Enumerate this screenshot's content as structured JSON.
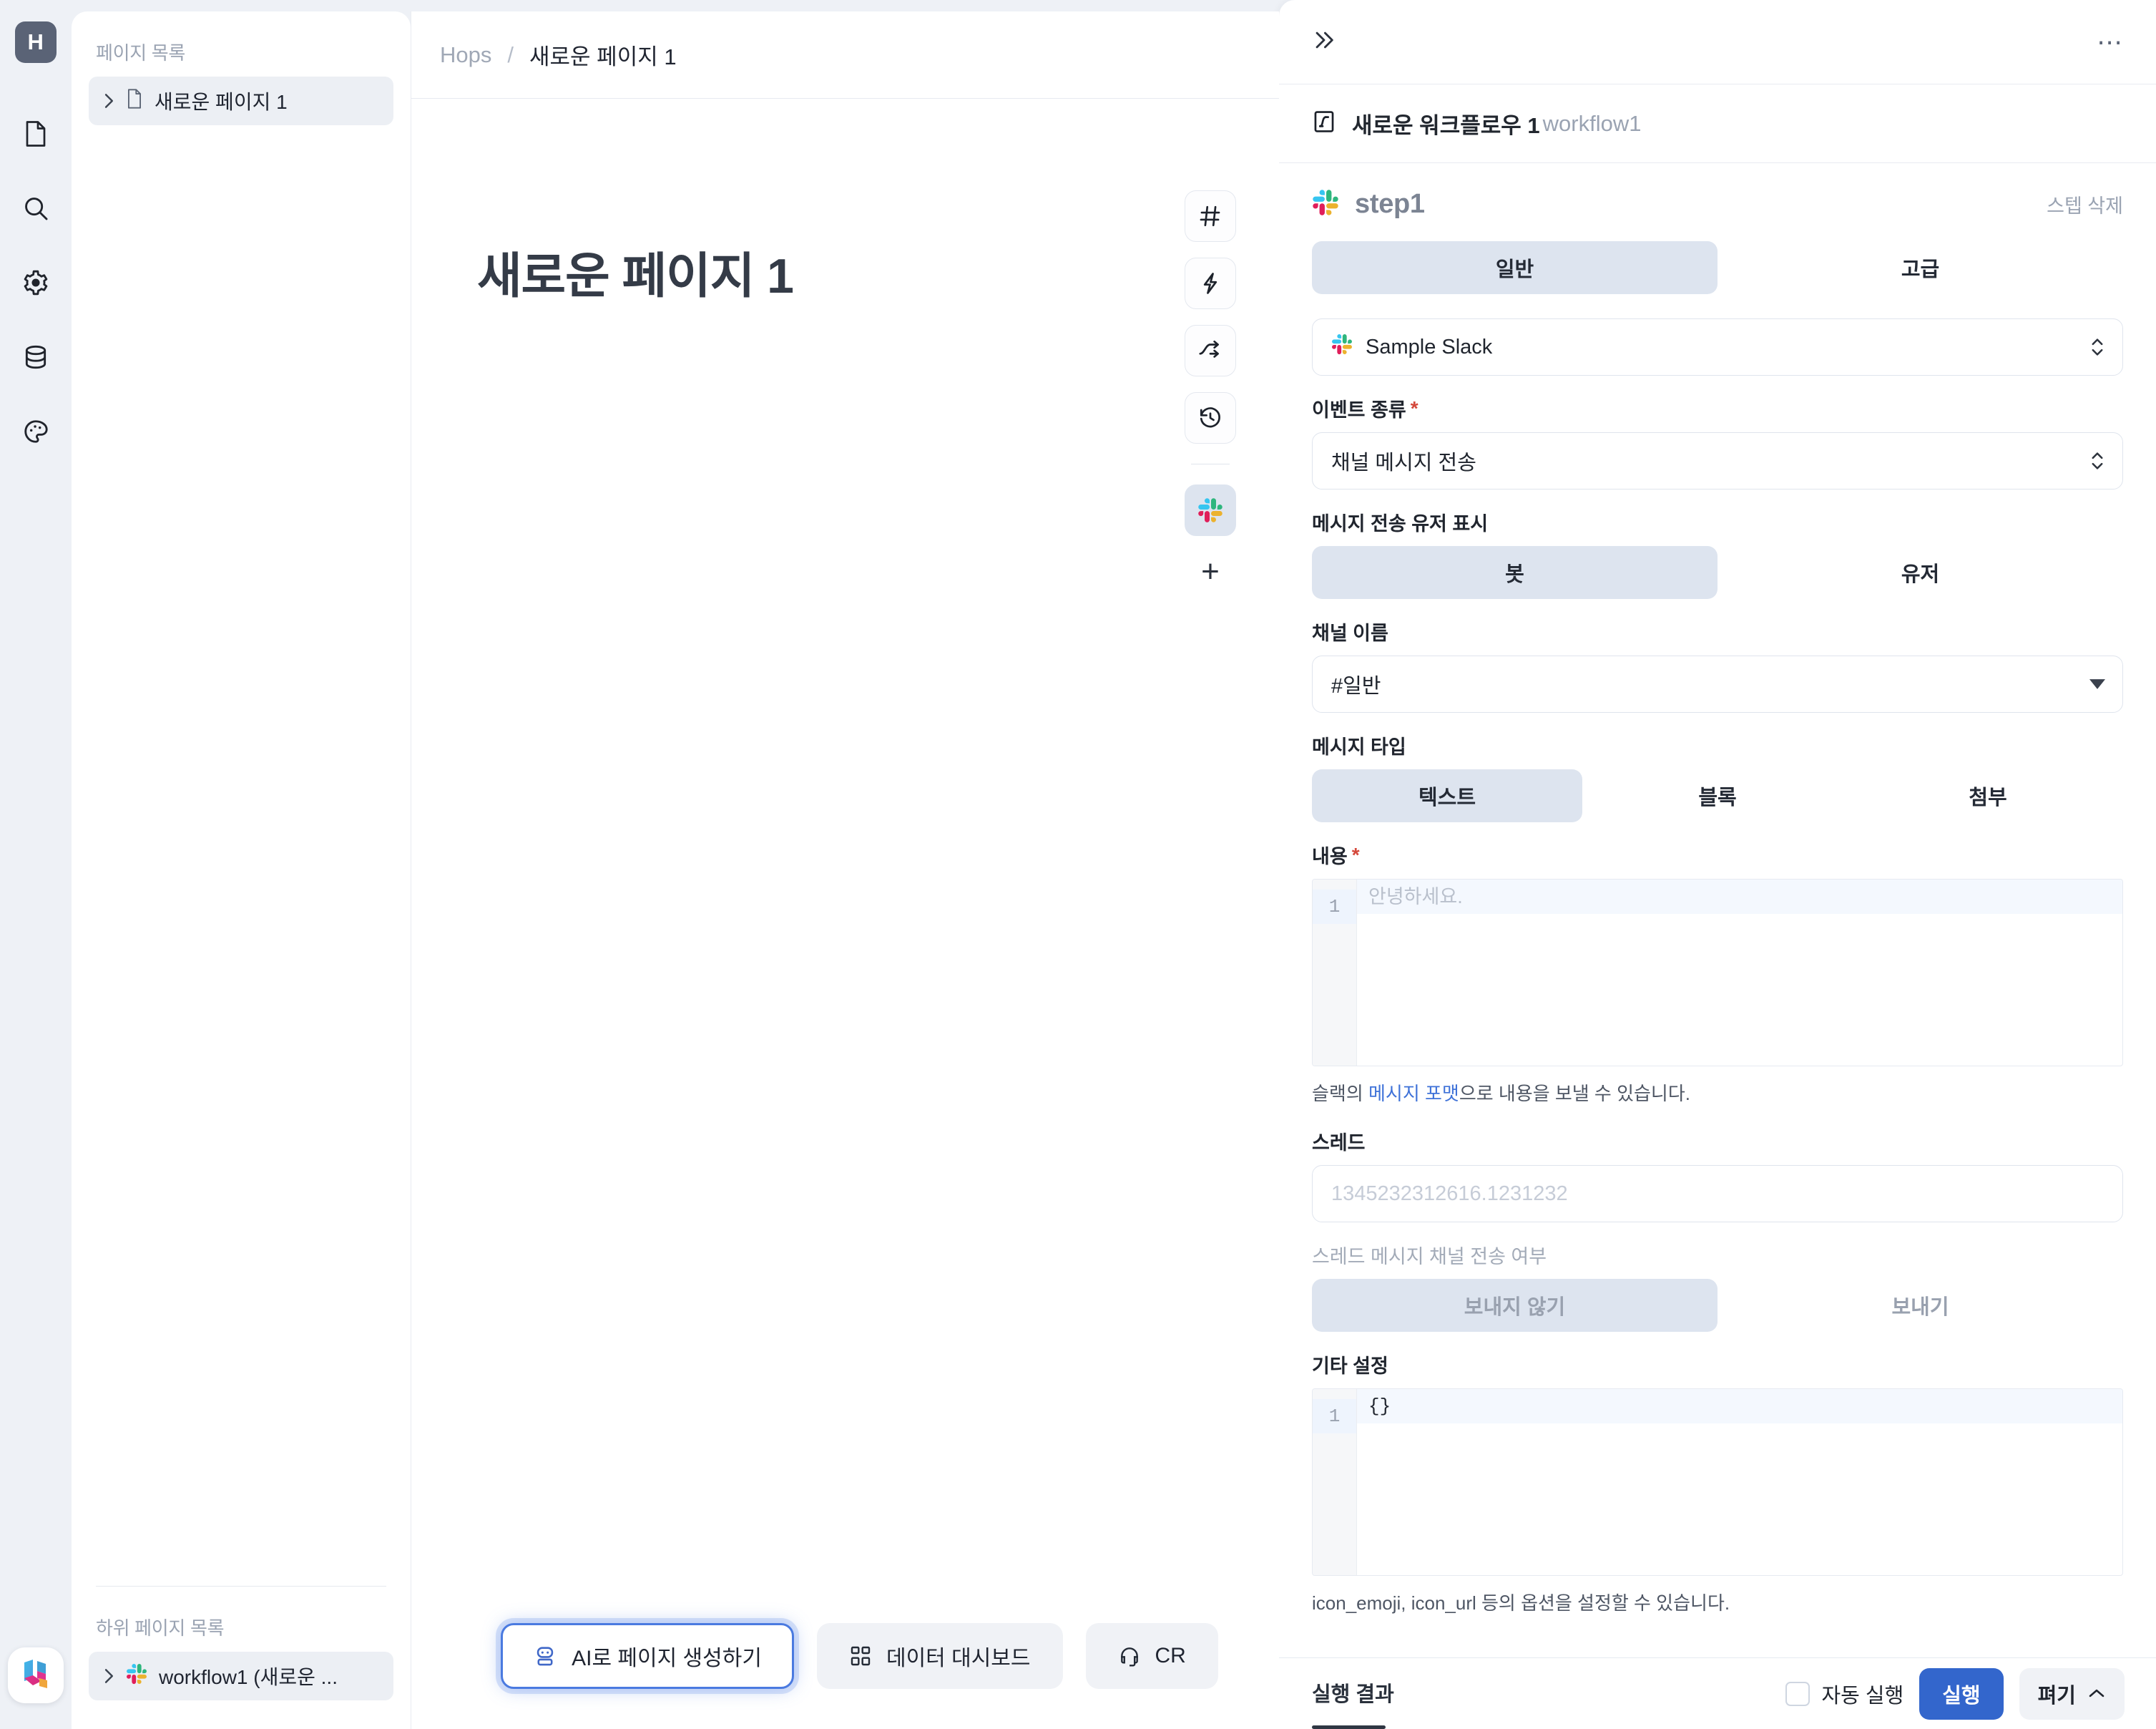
{
  "rail": {
    "logo_label": "H",
    "items": [
      {
        "name": "document-icon",
        "label": "문서"
      },
      {
        "name": "search-icon",
        "label": "검색"
      },
      {
        "name": "gear-icon",
        "label": "설정"
      },
      {
        "name": "database-icon",
        "label": "데이터"
      },
      {
        "name": "palette-icon",
        "label": "테마"
      }
    ]
  },
  "sidebar": {
    "page_list_label": "페이지 목록",
    "pages": [
      {
        "label": "새로운 페이지 1",
        "icon": "document-icon",
        "active": true
      }
    ],
    "sub_page_list_label": "하위 페이지 목록",
    "sub_pages": [
      {
        "label": "workflow1 (새로운 ...",
        "icon": "slack-icon",
        "active": true
      }
    ]
  },
  "breadcrumb": {
    "root": "Hops",
    "separator": "/",
    "current": "새로운 페이지 1"
  },
  "canvas": {
    "page_title": "새로운 페이지 1",
    "tools": [
      {
        "name": "hash-icon",
        "label": "#",
        "selected": false
      },
      {
        "name": "lightning-icon",
        "label": "이벤트",
        "selected": false
      },
      {
        "name": "branch-icon",
        "label": "분기",
        "selected": false
      },
      {
        "name": "history-icon",
        "label": "기록",
        "selected": false
      },
      {
        "name": "slack-icon",
        "label": "Slack",
        "selected": true
      }
    ],
    "add_label": "+",
    "chips": [
      {
        "label": "AI로 페이지 생성하기",
        "icon": "robot-icon",
        "highlight": true
      },
      {
        "label": "데이터 대시보드",
        "icon": "dashboard-icon",
        "highlight": false
      },
      {
        "label": "CR",
        "icon": "headset-icon",
        "highlight": false
      }
    ]
  },
  "panel": {
    "collapse_icon": "chevrons-right-icon",
    "more_icon": "more-horizontal-icon",
    "workflow": {
      "icon": "workflow-icon",
      "name": "새로운 워크플로우 1",
      "key": "workflow1"
    },
    "step": {
      "icon": "slack-icon",
      "name": "step1",
      "delete_label": "스텝 삭제"
    },
    "mode_tabs": [
      {
        "label": "일반",
        "selected": true
      },
      {
        "label": "고급",
        "selected": false
      }
    ],
    "connection": {
      "value": "Sample Slack",
      "icon": "slack-icon"
    },
    "event_type": {
      "label": "이벤트 종류",
      "required": true,
      "value": "채널 메시지 전송"
    },
    "sender_display": {
      "label": "메시지 전송 유저 표시",
      "options": [
        {
          "label": "봇",
          "selected": true
        },
        {
          "label": "유저",
          "selected": false
        }
      ]
    },
    "channel_name": {
      "label": "채널 이름",
      "value": "#일반"
    },
    "message_type": {
      "label": "메시지 타입",
      "options": [
        {
          "label": "텍스트",
          "selected": true
        },
        {
          "label": "블록",
          "selected": false
        },
        {
          "label": "첨부",
          "selected": false
        }
      ]
    },
    "content": {
      "label": "내용",
      "required": true,
      "line_number": "1",
      "placeholder": "안녕하세요.",
      "helper_prefix": "슬랙의 ",
      "helper_link": "메시지 포맷",
      "helper_suffix": "으로 내용을 보낼 수 있습니다."
    },
    "thread": {
      "label": "스레드",
      "placeholder": "1345232312616.1231232"
    },
    "thread_broadcast": {
      "label": "스레드 메시지 채널 전송 여부",
      "options": [
        {
          "label": "보내지 않기",
          "selected": true
        },
        {
          "label": "보내기",
          "selected": false
        }
      ]
    },
    "extra_settings": {
      "label": "기타 설정",
      "line_number": "1",
      "value": "{}",
      "helper": "icon_emoji, icon_url 등의 옵션을 설정할 수 있습니다."
    },
    "footer": {
      "result_tab": "실행 결과",
      "auto_run_label": "자동 실행",
      "auto_run_checked": false,
      "run_label": "실행",
      "expand_label": "펴기",
      "expand_icon": "chevron-up-icon"
    }
  },
  "colors": {
    "accent": "#3366cc",
    "highlight_border": "#4a7ae0",
    "segment_active_bg": "#dde4ef",
    "app_bg": "#eef1f6",
    "required_star": "#d4483b"
  }
}
